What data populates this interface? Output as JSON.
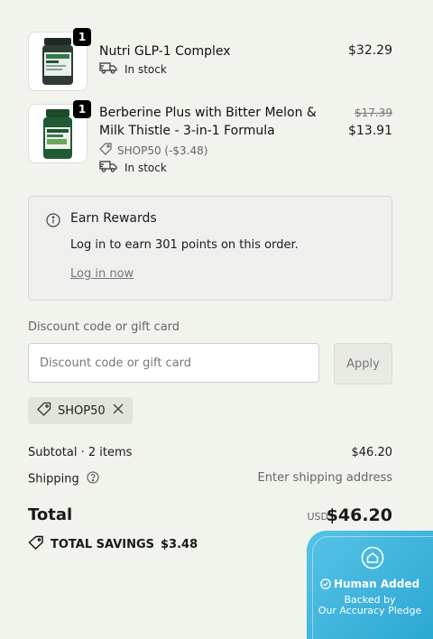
{
  "items": [
    {
      "quantity": "1",
      "name": "Nutri GLP-1 Complex",
      "stock": "In stock",
      "price": "$32.29"
    },
    {
      "quantity": "1",
      "name": "Berberine Plus with Bitter Melon & Milk Thistle - 3-in-1 Formula",
      "discount": "SHOP50 (-$3.48)",
      "stock": "In stock",
      "original_price": "$17.39",
      "price": "$13.91"
    }
  ],
  "rewards": {
    "title": "Earn Rewards",
    "message": "Log in to earn 301 points on this order.",
    "link": "Log in now"
  },
  "discount": {
    "label": "Discount code or gift card",
    "placeholder": "Discount code or gift card",
    "apply": "Apply",
    "applied_code": "SHOP50"
  },
  "summary": {
    "subtotal_label": "Subtotal · 2 items",
    "subtotal_value": "$46.20",
    "shipping_label": "Shipping",
    "shipping_value": "Enter shipping address",
    "total_label": "Total",
    "currency": "USD",
    "total_value": "$46.20",
    "savings_label": "TOTAL SAVINGS",
    "savings_value": "$3.48"
  },
  "badge": {
    "line1": "Human Added",
    "line2": "Backed by",
    "line3": "Our Accuracy Pledge"
  },
  "colors": {
    "background": "#f1f3ed",
    "chip": "#e0e5d9",
    "badge": "#3fb3dc"
  }
}
